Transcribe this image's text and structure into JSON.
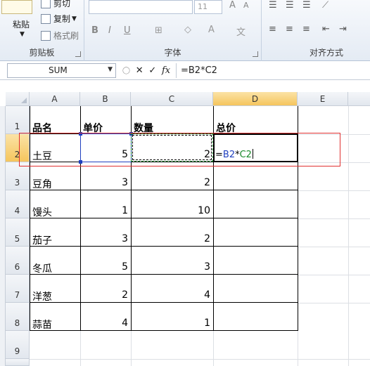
{
  "ribbon": {
    "clipboard": {
      "paste": "粘贴",
      "cut": "剪切",
      "copy": "复制",
      "format_painter": "格式刷",
      "label": "剪贴板"
    },
    "font": {
      "size": "11",
      "bold": "B",
      "italic": "I",
      "underline": "U",
      "label": "字体"
    },
    "alignment": {
      "label": "对齐方式"
    }
  },
  "formula_bar": {
    "name_box": "SUM",
    "cancel": "✕",
    "enter": "✓",
    "fx": "fx",
    "formula": "=B2*C2"
  },
  "columns": [
    "A",
    "B",
    "C",
    "D",
    "E"
  ],
  "rows": [
    "1",
    "2",
    "3",
    "4",
    "5",
    "6",
    "7",
    "8",
    "9"
  ],
  "headers": {
    "name": "品名",
    "price": "单价",
    "qty": "数量",
    "total": "总价"
  },
  "data": [
    {
      "name": "土豆",
      "price": "5",
      "qty": "2"
    },
    {
      "name": "豆角",
      "price": "3",
      "qty": "2"
    },
    {
      "name": "馒头",
      "price": "1",
      "qty": "10"
    },
    {
      "name": "茄子",
      "price": "3",
      "qty": "2"
    },
    {
      "name": "冬瓜",
      "price": "5",
      "qty": "3"
    },
    {
      "name": "洋葱",
      "price": "2",
      "qty": "4"
    },
    {
      "name": "蒜苗",
      "price": "4",
      "qty": "1"
    }
  ],
  "editing": {
    "eq": "=",
    "ref1": "B2",
    "op": "*",
    "ref2": "C2"
  },
  "colors": {
    "ref1": "#1f3fbf",
    "ref2": "#1a8a2a",
    "highlight": "#e03030",
    "selected_header": "#f5c55d"
  }
}
